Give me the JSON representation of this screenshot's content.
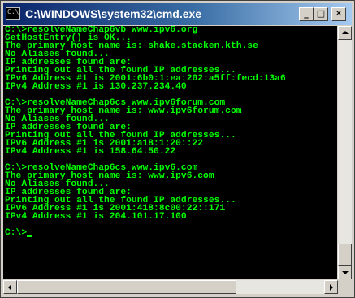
{
  "window": {
    "title": "C:\\WINDOWS\\system32\\cmd.exe",
    "icon": "cmd-icon",
    "icon_glyph": "C:\\",
    "buttons": {
      "minimize": "_",
      "maximize": "□",
      "close": "✕"
    }
  },
  "console": {
    "text_color": "#00ff00",
    "background": "#000000",
    "lines": [
      "C:\\>resolveNameChap6vb www.ipv6.org",
      "GetHostEntry() is OK...",
      "The primary host name is: shake.stacken.kth.se",
      "No Aliases found...",
      "IP addresses found are:",
      "Printing out all the found IP addresses...",
      "IPv6 Address #1 is 2001:6b0:1:ea:202:a5ff:fecd:13a6",
      "IPv4 Address #1 is 130.237.234.40",
      "",
      "C:\\>resolveNameChap6cs www.ipv6forum.com",
      "The primary host name is: www.ipv6forum.com",
      "No Aliases found...",
      "IP addresses found are:",
      "Printing out all the found IP addresses...",
      "IPv6 Address #1 is 2001:a18:1:20::22",
      "IPv4 Address #1 is 158.64.50.22",
      "",
      "C:\\>resolveNameChap6cs www.ipv6.com",
      "The primary host name is: www.ipv6.com",
      "No Aliases found...",
      "IP addresses found are:",
      "Printing out all the found IP addresses...",
      "IPv6 Address #1 is 2001:418:8c00:22::171",
      "IPv4 Address #1 is 204.101.17.100",
      "",
      "C:\\>"
    ]
  }
}
